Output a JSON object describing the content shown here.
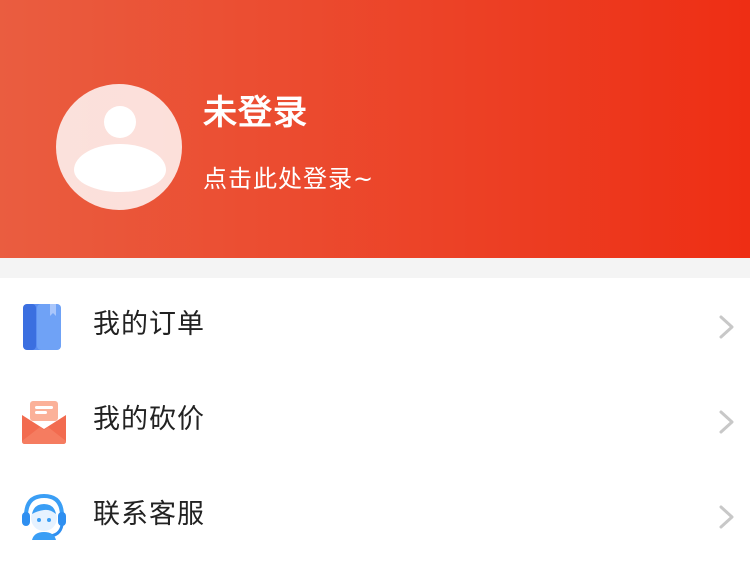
{
  "profile": {
    "name": "未登录",
    "login_hint": "点击此处登录~"
  },
  "menu": {
    "items": [
      {
        "label": "我的订单",
        "icon": "order-book-icon"
      },
      {
        "label": "我的砍价",
        "icon": "envelope-icon"
      },
      {
        "label": "联系客服",
        "icon": "customer-service-headset-icon"
      }
    ]
  },
  "colors": {
    "header_gradient_start": "#ea5d40",
    "header_gradient_end": "#ee2e14",
    "order_icon": "#4a86f0",
    "bargain_icon": "#f06a4e",
    "service_icon": "#3a9ef5",
    "chevron": "#c8c8c8"
  }
}
